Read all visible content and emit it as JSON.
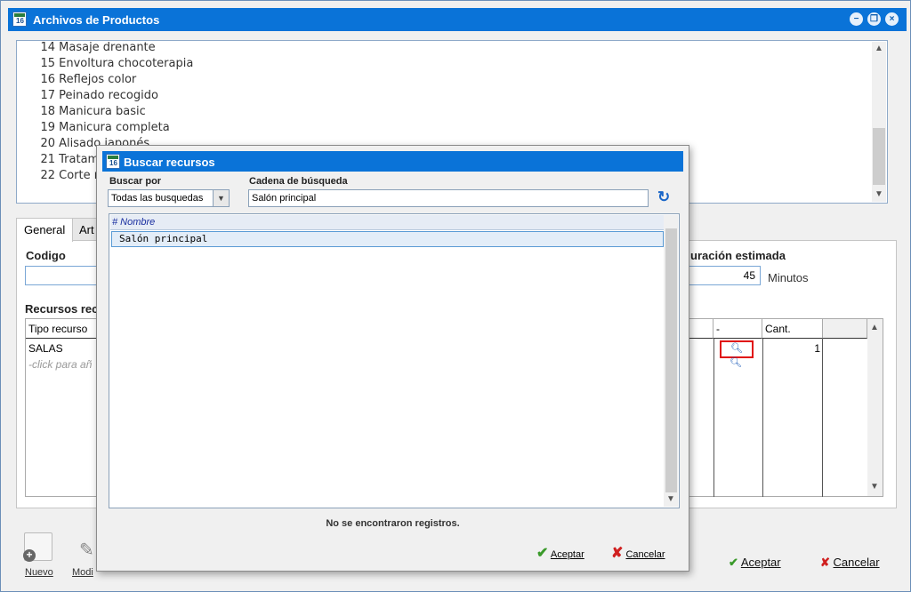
{
  "window": {
    "title": "Archivos de Productos",
    "controls": [
      "minimize",
      "restore",
      "close"
    ]
  },
  "product_list": {
    "rows": [
      {
        "num": "14",
        "name": "Masaje drenante"
      },
      {
        "num": "15",
        "name": "Envoltura chocoterapia"
      },
      {
        "num": "16",
        "name": "Reflejos color"
      },
      {
        "num": "17",
        "name": "Peinado recogido"
      },
      {
        "num": "18",
        "name": "Manicura basic"
      },
      {
        "num": "19",
        "name": "Manicura completa"
      },
      {
        "num": "20",
        "name": "Alisado japonés"
      },
      {
        "num": "21",
        "name": "Tratam"
      },
      {
        "num": "22",
        "name": "Corte r"
      }
    ]
  },
  "tabs": [
    {
      "label": "General",
      "active": true
    },
    {
      "label": "Art",
      "active": false
    }
  ],
  "general": {
    "codigo_label": "Codigo",
    "duracion_label": "uración estimada",
    "duracion_value": "45",
    "duracion_unit": "Minutos",
    "recursos_label": "Recursos rec",
    "grid": {
      "columns": [
        "Tipo recurso",
        "-",
        "Cant."
      ],
      "rows": [
        {
          "tipo": "SALAS",
          "cant": "1"
        }
      ],
      "add_hint": "-click para añ"
    }
  },
  "bottom_toolbar": {
    "nuevo": "Nuevo",
    "modificar": "Modi",
    "aceptar": "Aceptar",
    "cancelar": "Cancelar"
  },
  "dialog": {
    "title": "Buscar recursos",
    "buscar_por_label": "Buscar por",
    "buscar_por_value": "Todas las busquedas",
    "cadena_label": "Cadena de búsqueda",
    "cadena_value": "Salón principal",
    "results_header": "# Nombre",
    "results": [
      "Salón principal"
    ],
    "status": "No se encontraron registros.",
    "aceptar": "Aceptar",
    "cancelar": "Cancelar"
  },
  "colors": {
    "title_bar": "#0a73d8",
    "accept_icon": "#3a9a2a",
    "cancel_icon": "#d02020",
    "highlight_box": "#e01010"
  }
}
